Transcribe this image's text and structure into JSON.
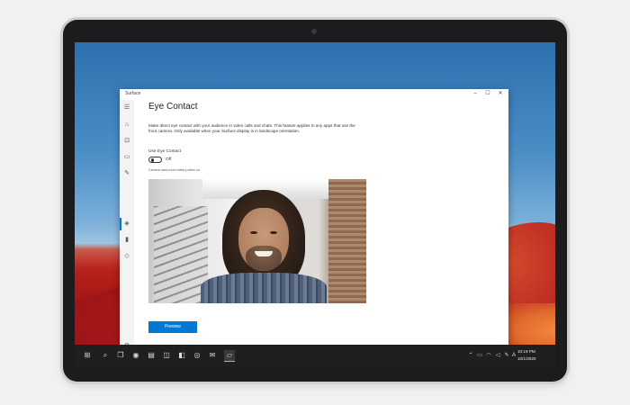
{
  "window": {
    "app_title": "Surface",
    "controls": {
      "minimize": "–",
      "maximize": "☐",
      "close": "✕"
    }
  },
  "nav_rail": {
    "items": [
      {
        "name": "menu",
        "icon": "☰"
      },
      {
        "name": "home",
        "icon": "⌂"
      },
      {
        "name": "devices",
        "icon": "⊡"
      },
      {
        "name": "battery",
        "icon": "▭"
      },
      {
        "name": "pen",
        "icon": "✎"
      },
      {
        "name": "camera",
        "icon": "◈"
      },
      {
        "name": "signal",
        "icon": "▮"
      },
      {
        "name": "shield",
        "icon": "◇"
      },
      {
        "name": "settings",
        "icon": "⚙"
      }
    ]
  },
  "page": {
    "title": "Eye Contact",
    "description": "Make direct eye contact with your audience in video calls and chats. This feature applies to any apps that use the front camera. Only available when your Surface display is in landscape orientation.",
    "toggle_label": "Use Eye Contact",
    "toggle_state": "Off",
    "battery_note": "Camera uses more battery when on",
    "preview_button": "Preview"
  },
  "taskbar": {
    "icons": [
      {
        "name": "start",
        "icon": "⊞"
      },
      {
        "name": "search",
        "icon": "⌕"
      },
      {
        "name": "task-view",
        "icon": "❐"
      },
      {
        "name": "edge",
        "icon": "◉"
      },
      {
        "name": "file-explorer",
        "icon": "▤"
      },
      {
        "name": "store",
        "icon": "◫"
      },
      {
        "name": "office",
        "icon": "◧"
      },
      {
        "name": "teams",
        "icon": "◎"
      },
      {
        "name": "outlook",
        "icon": "✉"
      },
      {
        "name": "surface-app",
        "icon": "▱"
      }
    ],
    "tray": [
      {
        "name": "chevron-up",
        "icon": "⌃"
      },
      {
        "name": "battery",
        "icon": "▭"
      },
      {
        "name": "wifi",
        "icon": "◠"
      },
      {
        "name": "volume",
        "icon": "◁"
      },
      {
        "name": "pen",
        "icon": "✎"
      },
      {
        "name": "language",
        "icon": "A"
      }
    ],
    "time": "10:19 PM",
    "date": "10/1/2020"
  },
  "colors": {
    "accent": "#0078d4",
    "taskbar": "#1f1f1f",
    "wallpaper_red": "#b8211c",
    "wallpaper_blue": "#4c8fc6"
  }
}
